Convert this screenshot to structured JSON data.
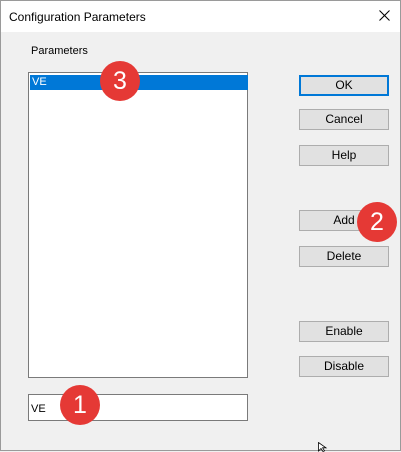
{
  "window": {
    "title": "Configuration Parameters"
  },
  "parameters": {
    "label": "Parameters",
    "items": [
      {
        "label": "VE",
        "selected": true
      }
    ]
  },
  "edit_field": {
    "value": "VE"
  },
  "buttons": {
    "ok": "OK",
    "cancel": "Cancel",
    "help": "Help",
    "add": "Add",
    "delete": "Delete",
    "enable": "Enable",
    "disable": "Disable"
  },
  "annotations": {
    "one": "1",
    "two": "2",
    "three": "3"
  },
  "colors": {
    "selection": "#0078d7",
    "badge": "#e53935",
    "default_button_border": "#0078d7"
  }
}
